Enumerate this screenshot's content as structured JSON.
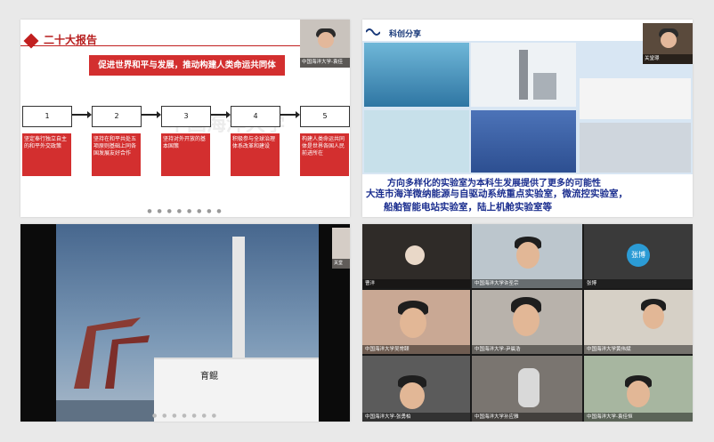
{
  "panel1": {
    "title": "二十大报告",
    "banner": "促进世界和平与发展，推动构建人类命运共同体",
    "steps": [
      {
        "num": "1",
        "text": "坚定奉行独立自主的和平外交政策"
      },
      {
        "num": "2",
        "text": "坚持在和平共处五项原则基础上同各国发展友好合作"
      },
      {
        "num": "3",
        "text": "坚持对外开放的基本国策"
      },
      {
        "num": "4",
        "text": "积极参与全球治理体系改革和建设"
      },
      {
        "num": "5",
        "text": "构建人类命运共同体是世界各国人民前进所在"
      }
    ],
    "presenter_label": "中国海洋大学-袁佳",
    "watermark": "中国海洋大学"
  },
  "panel2": {
    "title": "科创分享",
    "presenter_label": "关堂璟",
    "caption_line1": "方向多样化的实验室为本科生发展提供了更多的可能性",
    "caption_line2": "大连市海洋微纳能源与自驱动系统重点实验室，微流控实验室，",
    "caption_line3": "船舶智能电站实验室，陆上机舱实验室等"
  },
  "panel3": {
    "presenter_label": "关堂",
    "ship_name": "育鲲"
  },
  "panel4": {
    "participants": [
      {
        "name": "曹洋"
      },
      {
        "name": "中国海洋大学许圣宗"
      },
      {
        "name": "张博",
        "avatar_text": "张博"
      },
      {
        "name": "中国海洋大学吴常颐"
      },
      {
        "name": "中国海洋大学-尹晨浩"
      },
      {
        "name": "中国海洋大学黄伟斌"
      },
      {
        "name": "中国海洋大学-张勇柏"
      },
      {
        "name": "中国海洋大学孙应雅"
      },
      {
        "name": "中国海洋大学-袁佳恒"
      }
    ]
  },
  "colors": {
    "accent_red": "#d32f2f",
    "title_blue": "#1b2e8f",
    "avatar_blue": "#2b9bd5"
  }
}
